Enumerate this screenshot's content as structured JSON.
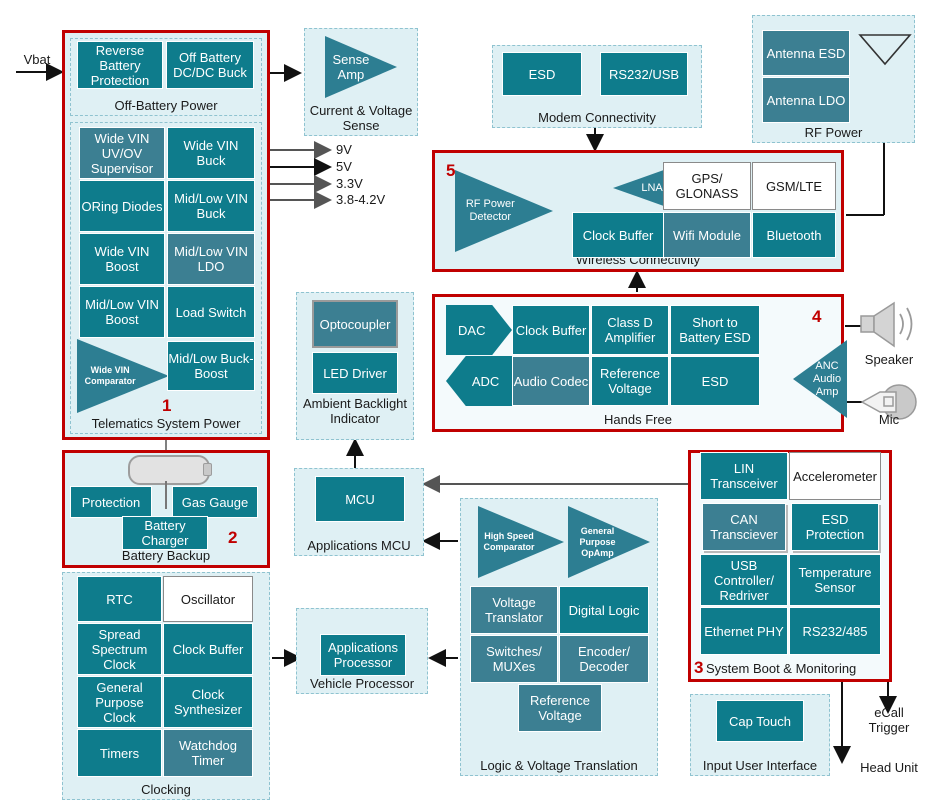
{
  "diagram": {
    "input_label": "Vbat",
    "rails": [
      "9V",
      "5V",
      "3.3V",
      "3.8-4.2V"
    ],
    "colors": {
      "teal": "#0e7c8c",
      "teal_light": "#3c7f92",
      "group_fill": "#dff0f4",
      "group_border": "#8fc3d0",
      "highlight": "#c00000",
      "text_light": "#ffffff",
      "text_dark": "#1a1a1a"
    },
    "numbers": {
      "one": "1",
      "two": "2",
      "three": "3",
      "four": "4",
      "five": "5"
    }
  },
  "groups": {
    "off_battery_power": {
      "label": "Off-Battery Power",
      "blocks": [
        "Reverse Battery Protection",
        "Off Battery DC/DC Buck"
      ]
    },
    "telematics_system_power": {
      "label": "Telematics System Power",
      "number": "1",
      "blocks": [
        "Wide VIN UV/OV Supervisor",
        "Wide VIN Buck",
        "ORing Diodes",
        "Mid/Low VIN Buck",
        "Wide VIN Boost",
        "Mid/Low VIN LDO",
        "Mid/Low VIN Boost",
        "Load Switch",
        "Mid/Low Buck-Boost"
      ],
      "amp": "Wide VIN Comparator"
    },
    "battery_backup": {
      "label": "Battery Backup",
      "number": "2",
      "blocks": [
        "Protection",
        "Gas Gauge",
        "Battery Charger"
      ],
      "icon": "battery-cell-icon"
    },
    "clocking": {
      "label": "Clocking",
      "blocks": [
        "RTC",
        "Oscillator",
        "Spread Spectrum Clock",
        "Clock Buffer",
        "General Purpose Clock",
        "Clock Synthesizer",
        "Timers",
        "Watchdog Timer"
      ]
    },
    "current_voltage_sense": {
      "label": "Current & Voltage Sense",
      "amp": "Sense Amp"
    },
    "ambient_backlight": {
      "label": "Ambient Backlight Indicator",
      "blocks": [
        "Optocoupler",
        "LED Driver"
      ]
    },
    "applications_mcu": {
      "label": "Applications MCU",
      "blocks": [
        "MCU"
      ]
    },
    "vehicle_processor": {
      "label": "Vehicle Processor",
      "blocks": [
        "Applications Processor"
      ]
    },
    "logic_voltage_translation": {
      "label": "Logic & Voltage Translation",
      "amps": [
        "High Speed Comparator",
        "General Purpose OpAmp"
      ],
      "blocks": [
        "Voltage Translator",
        "Digital Logic",
        "Switches/ MUXes",
        "Encoder/ Decoder",
        "Reference Voltage"
      ]
    },
    "modem_connectivity": {
      "label": "Modem Connectivity",
      "blocks": [
        "ESD",
        "RS232/USB"
      ]
    },
    "rf_power": {
      "label": "RF Power",
      "blocks": [
        "Antenna ESD",
        "Antenna LDO"
      ],
      "icon": "antenna-icon"
    },
    "wireless_connectivity": {
      "label": "Wireless Connectivity",
      "number": "5",
      "amp": "RF Power Detector",
      "lna": "LNA",
      "blocks": [
        "GPS/ GLONASS",
        "GSM/LTE",
        "Clock Buffer",
        "Wifi Module",
        "Bluetooth"
      ]
    },
    "hands_free": {
      "label": "Hands Free",
      "number": "4",
      "blocks": [
        "DAC",
        "Clock Buffer",
        "Class D Amplifier",
        "Short to Battery ESD",
        "ADC",
        "Audio Codec",
        "Reference Voltage",
        "ESD"
      ],
      "anc_amp": "ANC Audio Amp"
    },
    "system_boot_monitoring": {
      "label": "System Boot & Monitoring",
      "number": "3",
      "blocks": [
        "LIN Transceiver",
        "Accelerometer",
        "CAN Transciever",
        "ESD Protection",
        "USB Controller/ Redriver",
        "Temperature Sensor",
        "Ethernet PHY",
        "RS232/485"
      ]
    },
    "input_user_interface": {
      "label": "Input User Interface",
      "blocks": [
        "Cap Touch"
      ]
    }
  },
  "peripherals": {
    "speaker": "Speaker",
    "mic": "Mic",
    "ecall_trigger": "eCall Trigger",
    "head_unit": "Head Unit"
  }
}
